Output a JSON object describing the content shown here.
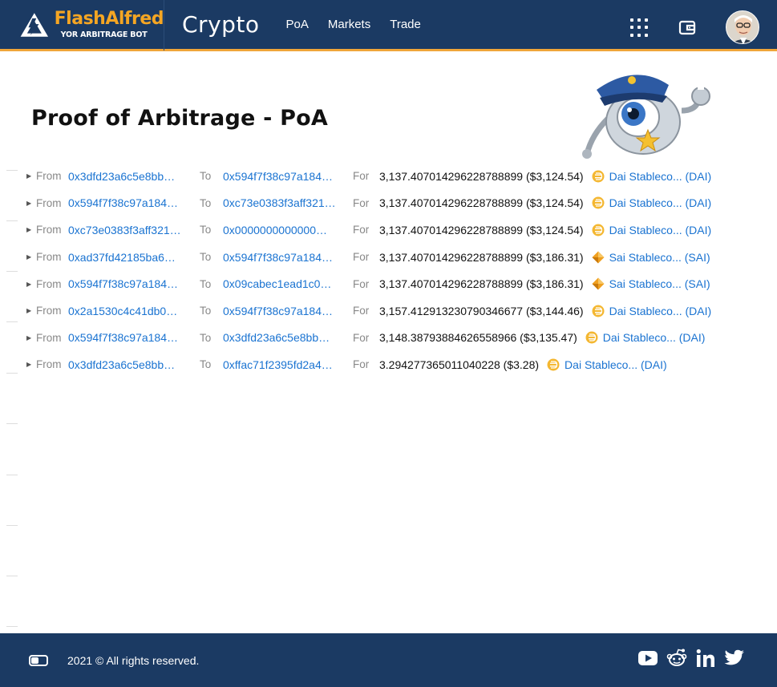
{
  "header": {
    "brand_name": "FlashAlfred",
    "brand_tagline": "YOR ARBITRAGE BOT",
    "section_title": "Crypto",
    "nav": [
      "PoA",
      "Markets",
      "Trade"
    ]
  },
  "page": {
    "title": "Proof of Arbitrage - PoA"
  },
  "transactions": {
    "labels": {
      "from": "From",
      "to": "To",
      "for": "For"
    },
    "rows": [
      {
        "from": "0x3dfd23a6c5e8bb…",
        "to": "0x594f7f38c97a184…",
        "amount": "3,137.407014296228788899 ($3,124.54)",
        "token": "Dai Stableco... (DAI)",
        "token_icon": "dai-icon"
      },
      {
        "from": "0x594f7f38c97a184…",
        "to": "0xc73e0383f3aff321…",
        "amount": "3,137.407014296228788899 ($3,124.54)",
        "token": "Dai Stableco... (DAI)",
        "token_icon": "dai-icon"
      },
      {
        "from": "0xc73e0383f3aff321…",
        "to": "0x0000000000000…",
        "amount": "3,137.407014296228788899 ($3,124.54)",
        "token": "Dai Stableco... (DAI)",
        "token_icon": "dai-icon"
      },
      {
        "from": "0xad37fd42185ba6…",
        "to": "0x594f7f38c97a184…",
        "amount": "3,137.407014296228788899 ($3,186.31)",
        "token": "Sai Stableco... (SAI)",
        "token_icon": "sai-icon"
      },
      {
        "from": "0x594f7f38c97a184…",
        "to": "0x09cabec1ead1c0…",
        "amount": "3,137.407014296228788899 ($3,186.31)",
        "token": "Sai Stableco... (SAI)",
        "token_icon": "sai-icon"
      },
      {
        "from": "0x2a1530c4c41db0…",
        "to": "0x594f7f38c97a184…",
        "amount": "3,157.412913230790346677 ($3,144.46)",
        "token": "Dai Stableco... (DAI)",
        "token_icon": "dai-icon"
      },
      {
        "from": "0x594f7f38c97a184…",
        "to": "0x3dfd23a6c5e8bb…",
        "amount": "3,148.38793884626558966 ($3,135.47)",
        "token": "Dai Stableco... (DAI)",
        "token_icon": "dai-icon"
      },
      {
        "from": "0x3dfd23a6c5e8bb…",
        "to": "0xffac71f2395fd2a4…",
        "amount": "3.294277365011040228 ($3.28)",
        "token": "Dai Stableco... (DAI)",
        "token_icon": "dai-icon"
      }
    ]
  },
  "footer": {
    "copyright": "2021 © All rights reserved.",
    "socials": [
      "youtube-icon",
      "reddit-icon",
      "linkedin-icon",
      "twitter-icon"
    ]
  },
  "colors": {
    "header_bg": "#1b3a63",
    "brand_accent": "#f5a623",
    "link": "#1a73d1",
    "dai": "#f4b731",
    "sai": "#f0a020"
  }
}
